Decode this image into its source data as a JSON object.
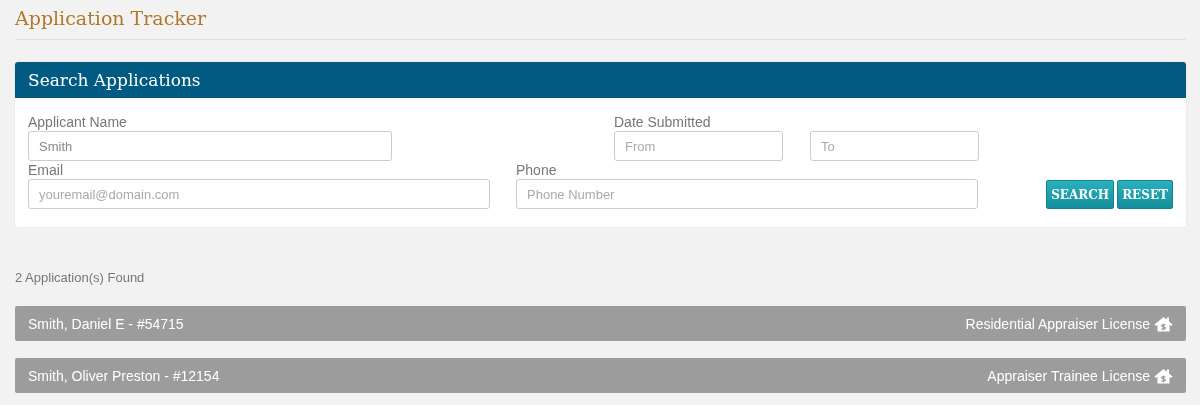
{
  "page_title": "Application Tracker",
  "search_panel": {
    "title": "Search Applications",
    "applicant_name": {
      "label": "Applicant Name",
      "value": "Smith"
    },
    "date_submitted": {
      "label": "Date Submitted",
      "from": {
        "placeholder": "From"
      },
      "to": {
        "placeholder": "To"
      }
    },
    "email": {
      "label": "Email",
      "placeholder": "youremail@domain.com"
    },
    "phone": {
      "label": "Phone",
      "placeholder": "Phone Number"
    },
    "buttons": [
      "SEARCH",
      "RESET"
    ]
  },
  "results_count": "2 Application(s) Found",
  "applications": [
    {
      "name": "Smith, Daniel E - #54715",
      "license": "Residential Appraiser License"
    },
    {
      "name": "Smith, Oliver Preston - #12154",
      "license": "Appraiser Trainee License"
    }
  ]
}
